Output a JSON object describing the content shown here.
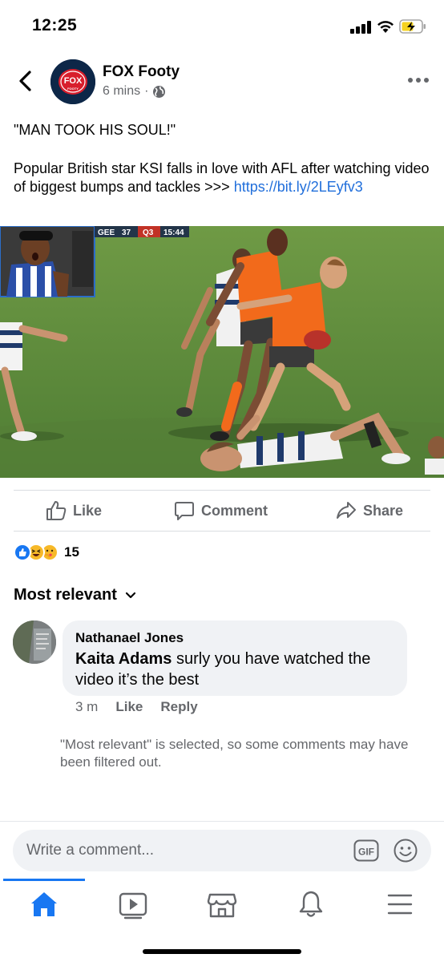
{
  "status_bar": {
    "time": "12:25"
  },
  "header": {
    "page_name": "FOX Footy",
    "post_age": "6 mins",
    "avatar_logo_text": "FOX",
    "avatar_logo_subtext": "FOOTY"
  },
  "post": {
    "headline": "\"MAN TOOK HIS SOUL!\"",
    "body_text": "Popular British star KSI falls in love with AFL after watching video of biggest bumps and tackles >>> ",
    "link_text": "https://bit.ly/2LEyfv3"
  },
  "video": {
    "score_team": "GEE",
    "score_value": "37",
    "quarter": "Q3",
    "clock": "15:44"
  },
  "actions": {
    "like": "Like",
    "comment": "Comment",
    "share": "Share"
  },
  "reactions": {
    "count": "15",
    "types": [
      "like-icon",
      "haha-icon",
      "care-icon"
    ]
  },
  "comments_sort": {
    "label": "Most relevant"
  },
  "comment": {
    "author": "Nathanael Jones",
    "mention": "Kaita Adams",
    "text": " surly you have watched the video it’s the best",
    "age": "3 m",
    "like": "Like",
    "reply": "Reply"
  },
  "filter_note": "\"Most relevant\" is selected, so some comments may have been filtered out.",
  "composer": {
    "placeholder": "Write a comment...",
    "gif_label": "GIF"
  },
  "tab_bar": {
    "tabs": [
      "home-icon",
      "watch-icon",
      "marketplace-icon",
      "notifications-icon",
      "menu-icon"
    ],
    "active": "home-icon"
  },
  "colors": {
    "accent": "#1877f2",
    "link": "#216fdb",
    "secondary_text": "#65676b",
    "bubble": "#f0f2f5",
    "fox_navy": "#0d2748",
    "fox_red": "#d81e2c",
    "orange_jersey": "#f26a1b",
    "field_green": "#5c8a3a"
  }
}
